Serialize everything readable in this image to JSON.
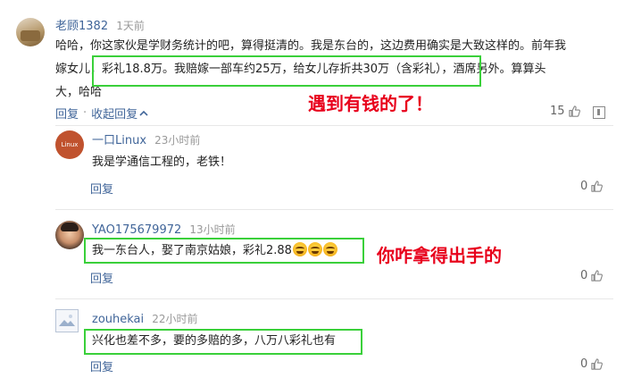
{
  "main_comment": {
    "username": "老顾1382",
    "time": "1天前",
    "text_line1": "哈哈，你这家伙是学财务统计的吧，算得挺清的。我是东台的，这边费用确实是大致这样的。前年我",
    "text_line2": "嫁女儿，彩礼18.8万。我赔嫁一部车约25万，给女儿存折共30万（含彩礼），酒席另外。算算头",
    "text_line3": "大，哈哈",
    "reply_label": "回复",
    "dot": "·",
    "collapse_label": "收起回复",
    "like_count": "15"
  },
  "replies": [
    {
      "username": "一口Linux",
      "time": "23小时前",
      "text": "我是学通信工程的，老铁！",
      "reply_label": "回复",
      "like_count": "0",
      "avatar_text": "Linux",
      "avatar_color": "#c0522e"
    },
    {
      "username": "YAO175679972",
      "time": "13小时前",
      "text": "我一东台人，娶了南京姑娘，彩礼2.88",
      "reply_label": "回复",
      "like_count": "0"
    },
    {
      "username": "zouhekai",
      "time": "22小时前",
      "text": "兴化也差不多，要的多赔的多，八万八彩礼也有",
      "reply_label": "回复",
      "like_count": "0"
    }
  ],
  "annotations": {
    "rich": "遇到有钱的了！",
    "how_dare": "你咋拿得出手的"
  },
  "colors": {
    "link": "#406599",
    "highlight_box": "#3ad03a",
    "annotation": "#e8001c"
  }
}
